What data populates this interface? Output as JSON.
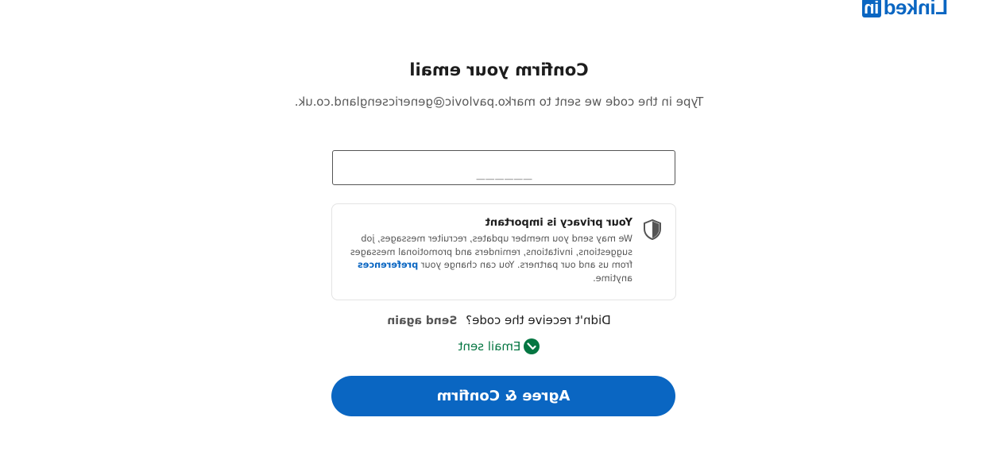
{
  "logo": {
    "text": "Linked",
    "box": "in"
  },
  "title": "Confirm your email",
  "subtitle": "Type in the code we sent to marko.pavlovic@genericsengland.co.uk.",
  "code_input": {
    "value": "______"
  },
  "privacy": {
    "heading": "Your privacy is important",
    "body": "We may send you member updates, recruiter messages, job suggestions, invitations, reminders and promotional messages from us and our partners. You can change your",
    "link": "preferences",
    "tail": "anytime."
  },
  "resend": {
    "prompt": "Didn't receive the code?",
    "action": "Send again"
  },
  "status": {
    "text": "Email sent"
  },
  "confirm_button": {
    "label": "Agree & Confirm"
  },
  "colors": {
    "brand": "#0a66c2",
    "success": "#057642"
  },
  "icons": [
    "shield-icon",
    "checkmark-icon"
  ]
}
